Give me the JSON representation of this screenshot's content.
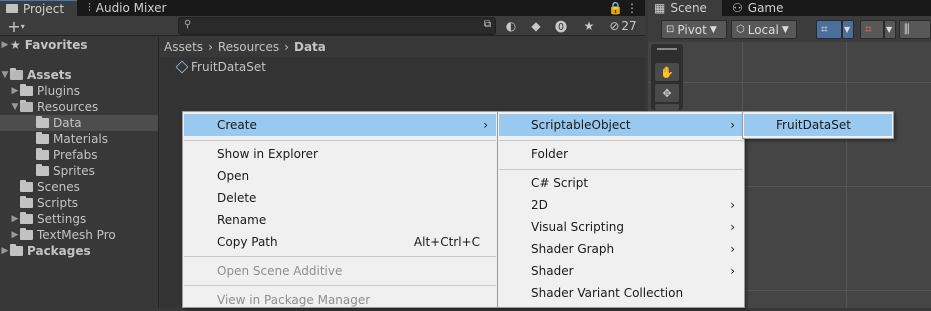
{
  "tabs": {
    "project": "Project",
    "audio_mixer": "Audio Mixer",
    "scene": "Scene",
    "game": "Game"
  },
  "toolbar": {
    "add_label": "+",
    "search_placeholder": "",
    "hidden_count": "27"
  },
  "scene_toolbar": {
    "pivot": "Pivot",
    "local": "Local"
  },
  "tree": {
    "favorites": "Favorites",
    "assets": "Assets",
    "plugins": "Plugins",
    "resources": "Resources",
    "data": "Data",
    "materials": "Materials",
    "prefabs": "Prefabs",
    "sprites": "Sprites",
    "scenes": "Scenes",
    "scripts": "Scripts",
    "settings": "Settings",
    "textmesh_pro": "TextMesh Pro",
    "packages": "Packages"
  },
  "breadcrumb": {
    "assets": "Assets",
    "resources": "Resources",
    "data": "Data",
    "separator": "›"
  },
  "asset": {
    "name": "FruitDataSet"
  },
  "menu1": {
    "create": "Create",
    "show_in_explorer": "Show in Explorer",
    "open": "Open",
    "delete": "Delete",
    "rename": "Rename",
    "copy_path": "Copy Path",
    "copy_path_shortcut": "Alt+Ctrl+C",
    "open_scene_additive": "Open Scene Additive",
    "view_in_package_manager": "View in Package Manager"
  },
  "menu2": {
    "scriptable_object": "ScriptableObject",
    "folder": "Folder",
    "csharp_script": "C# Script",
    "two_d": "2D",
    "visual_scripting": "Visual Scripting",
    "shader_graph": "Shader Graph",
    "shader": "Shader",
    "shader_variant_collection": "Shader Variant Collection"
  },
  "menu3": {
    "fruit_data_set": "FruitDataSet"
  },
  "colors": {
    "menu_highlight": "#99c9ef",
    "menu_bg": "#f0f0f0",
    "panel_bg": "#383838",
    "selected_row": "#4d4d4d"
  }
}
